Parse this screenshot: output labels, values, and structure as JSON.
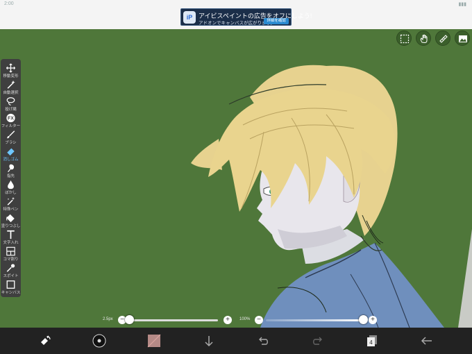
{
  "ad": {
    "logo_text": "iP",
    "title": "アイビスペイントの広告をオフにしよう!",
    "subtitle": "アドオンでキャンバスが広がります。",
    "button": "詳細を確認"
  },
  "toolbar": {
    "tools": [
      {
        "label": "移動変形",
        "icon": "move-icon"
      },
      {
        "label": "自動選択",
        "icon": "magic-wand-icon"
      },
      {
        "label": "投げ縄",
        "icon": "lasso-icon"
      },
      {
        "label": "フィルター",
        "icon": "fx-icon"
      },
      {
        "label": "ブラシ",
        "icon": "brush-icon"
      },
      {
        "label": "消しゴム",
        "icon": "eraser-icon"
      },
      {
        "label": "指先",
        "icon": "smudge-icon"
      },
      {
        "label": "ぼかし",
        "icon": "blur-drop-icon"
      },
      {
        "label": "特殊ペン",
        "icon": "special-pen-icon"
      },
      {
        "label": "塗りつぶし",
        "icon": "fill-bucket-icon"
      },
      {
        "label": "文字入れ",
        "icon": "text-icon"
      },
      {
        "label": "コマ割り",
        "icon": "frame-divider-icon"
      },
      {
        "label": "スポイト",
        "icon": "eyedropper-icon"
      },
      {
        "label": "キャンバス",
        "icon": "canvas-icon"
      }
    ],
    "active_index": 5
  },
  "sliders": {
    "size_value": "2.5px",
    "size_level": 0,
    "opacity_value": "100%",
    "opacity_level": 1
  },
  "bottombar": {
    "layer_count": "4"
  },
  "colors": {
    "canvas_bg": "#4f773a",
    "accent": "#6ec6ff",
    "toolbar_bg": "#3f3f3f",
    "bottom_bar_bg": "#222222",
    "hair": "#e7d28f",
    "skin": "#e8e6ec",
    "kimono": "#6f8fbd"
  }
}
